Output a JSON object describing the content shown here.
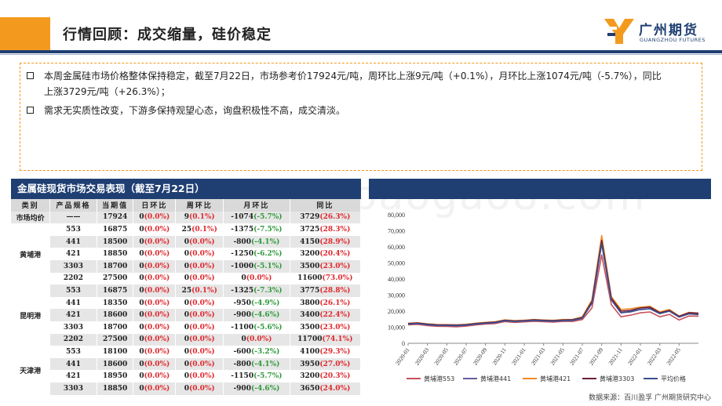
{
  "header": {
    "title": "行情回顾：成交缩量，硅价稳定",
    "logo_cn": "广州期货",
    "logo_en": "GUANGZHOU FUTURES"
  },
  "summary": {
    "bullets": [
      "本周金属硅市场价格整体保持稳定，截至7月22日，市场参考价17924元/吨，周环比上涨9元/吨（+0.1%），月环比上涨1074元/吨（-5.7%），同比上涨3729元/吨（+26.3%）；",
      "需求无实质性改变，下游多保持观望心态，询盘积极性不高，成交清淡。"
    ]
  },
  "table": {
    "title": "金属硅现货市场交易表现（截至7月22日）",
    "headers": [
      "类别",
      "产品规格",
      "当期值",
      "日环比",
      "周环比",
      "月环比",
      "同比"
    ],
    "group_labels": {
      "avg": "市场均价",
      "huangpu": "黄埔港",
      "kunming": "昆明港",
      "tianjin": "天津港"
    },
    "rows": [
      {
        "spec": "——",
        "val": "17924",
        "d": "0",
        "dp": "(0.0%)",
        "w": "9",
        "wp": "(0.1%)",
        "m": "-1074",
        "mp": "(-5.7%)",
        "y": "3729",
        "yp": "(26.3%)"
      },
      {
        "spec": "553",
        "val": "16875",
        "d": "0",
        "dp": "(0.0%)",
        "w": "25",
        "wp": "(0.1%)",
        "m": "-1375",
        "mp": "(-7.5%)",
        "y": "3725",
        "yp": "(28.3%)"
      },
      {
        "spec": "441",
        "val": "18500",
        "d": "0",
        "dp": "(0.0%)",
        "w": "0",
        "wp": "(0.0%)",
        "m": "-800",
        "mp": "(-4.1%)",
        "y": "4150",
        "yp": "(28.9%)"
      },
      {
        "spec": "421",
        "val": "18850",
        "d": "0",
        "dp": "(0.0%)",
        "w": "0",
        "wp": "(0.0%)",
        "m": "-1250",
        "mp": "(-6.2%)",
        "y": "3200",
        "yp": "(20.4%)"
      },
      {
        "spec": "3303",
        "val": "18700",
        "d": "0",
        "dp": "(0.0%)",
        "w": "0",
        "wp": "(0.0%)",
        "m": "-1000",
        "mp": "(-5.1%)",
        "y": "3500",
        "yp": "(23.0%)"
      },
      {
        "spec": "2202",
        "val": "27500",
        "d": "0",
        "dp": "(0.0%)",
        "w": "0",
        "wp": "(0.0%)",
        "m": "0",
        "mp": "(0.0%)",
        "y": "11600",
        "yp": "(73.0%)"
      },
      {
        "spec": "553",
        "val": "16875",
        "d": "0",
        "dp": "(0.0%)",
        "w": "25",
        "wp": "(0.1%)",
        "m": "-1325",
        "mp": "(-7.3%)",
        "y": "3775",
        "yp": "(28.8%)"
      },
      {
        "spec": "441",
        "val": "18350",
        "d": "0",
        "dp": "(0.0%)",
        "w": "0",
        "wp": "(0.0%)",
        "m": "-950",
        "mp": "(-4.9%)",
        "y": "3800",
        "yp": "(26.1%)"
      },
      {
        "spec": "421",
        "val": "18600",
        "d": "0",
        "dp": "(0.0%)",
        "w": "0",
        "wp": "(0.0%)",
        "m": "-900",
        "mp": "(-4.6%)",
        "y": "3400",
        "yp": "(22.4%)"
      },
      {
        "spec": "3303",
        "val": "18700",
        "d": "0",
        "dp": "(0.0%)",
        "w": "0",
        "wp": "(0.0%)",
        "m": "-1100",
        "mp": "(-5.6%)",
        "y": "3500",
        "yp": "(23.0%)"
      },
      {
        "spec": "2202",
        "val": "27500",
        "d": "0",
        "dp": "(0.0%)",
        "w": "0",
        "wp": "(0.0%)",
        "m": "0",
        "mp": "(0.0%)",
        "y": "11700",
        "yp": "(74.1%)"
      },
      {
        "spec": "553",
        "val": "18100",
        "d": "0",
        "dp": "(0.0%)",
        "w": "0",
        "wp": "(0.0%)",
        "m": "-600",
        "mp": "(-3.2%)",
        "y": "4100",
        "yp": "(29.3%)"
      },
      {
        "spec": "441",
        "val": "18600",
        "d": "0",
        "dp": "(0.0%)",
        "w": "0",
        "wp": "(0.0%)",
        "m": "-800",
        "mp": "(-4.1%)",
        "y": "3950",
        "yp": "(27.0%)"
      },
      {
        "spec": "421",
        "val": "18950",
        "d": "0",
        "dp": "(0.0%)",
        "w": "0",
        "wp": "(0.0%)",
        "m": "-1150",
        "mp": "(-5.7%)",
        "y": "3200",
        "yp": "(20.3%)"
      },
      {
        "spec": "3303",
        "val": "18850",
        "d": "0",
        "dp": "(0.0%)",
        "w": "0",
        "wp": "(0.0%)",
        "m": "-900",
        "mp": "(-4.6%)",
        "y": "3650",
        "yp": "(24.0%)"
      }
    ]
  },
  "colors": {
    "up": "#e0282e",
    "down": "#2e9a3a",
    "header_bar": "#1f3f73",
    "accent": "#f39a1e"
  },
  "chart_data": {
    "type": "line",
    "title": "",
    "ylim": [
      0,
      80000
    ],
    "yticks": [
      0,
      10000,
      20000,
      30000,
      40000,
      50000,
      60000,
      70000,
      80000
    ],
    "ytick_labels": [
      "0",
      "10,000",
      "20,000",
      "30,000",
      "40,000",
      "50,000",
      "60,000",
      "70,000",
      "80,000"
    ],
    "xtick_labels": [
      "2020-01",
      "2020-03",
      "2020-05",
      "2020-07",
      "2020-09",
      "2020-11",
      "2021-01",
      "2021-03",
      "2021-05",
      "2021-07",
      "2021-09",
      "2021-11",
      "2022-01",
      "2022-03",
      "2022-05"
    ],
    "x": [
      "2020-01",
      "2020-02",
      "2020-03",
      "2020-04",
      "2020-05",
      "2020-06",
      "2020-07",
      "2020-08",
      "2020-09",
      "2020-10",
      "2020-11",
      "2020-12",
      "2021-01",
      "2021-02",
      "2021-03",
      "2021-04",
      "2021-05",
      "2021-06",
      "2021-07",
      "2021-08",
      "2021-09",
      "2021-10",
      "2021-11",
      "2021-12",
      "2022-01",
      "2022-02",
      "2022-03",
      "2022-04",
      "2022-05",
      "2022-06",
      "2022-07"
    ],
    "series": [
      {
        "name": "黄埔港553",
        "color": "#c8505a",
        "values": [
          11500,
          11800,
          11000,
          10600,
          10500,
          10300,
          10700,
          11400,
          12000,
          12300,
          13500,
          13000,
          13300,
          13700,
          13400,
          13200,
          13600,
          13600,
          14800,
          22000,
          55000,
          24000,
          16500,
          17500,
          19000,
          19500,
          16500,
          18000,
          14500,
          17000,
          16900
        ]
      },
      {
        "name": "黄埔港441",
        "color": "#6a5aa0",
        "values": [
          12000,
          12300,
          11500,
          11100,
          11000,
          10900,
          11200,
          11900,
          12500,
          12800,
          14000,
          13500,
          13800,
          14200,
          13900,
          13700,
          14100,
          14200,
          15600,
          25000,
          62000,
          27000,
          19000,
          19500,
          21000,
          21500,
          18500,
          20000,
          16500,
          18800,
          18500
        ]
      },
      {
        "name": "黄埔港421",
        "color": "#f08a24",
        "values": [
          12500,
          12800,
          12100,
          11700,
          11600,
          11500,
          11800,
          12500,
          13000,
          13400,
          14600,
          14100,
          14400,
          14800,
          14500,
          14300,
          14800,
          14900,
          16500,
          27000,
          67000,
          29000,
          21000,
          21500,
          22500,
          23000,
          19500,
          21000,
          17000,
          19200,
          18850
        ]
      },
      {
        "name": "黄埔港3303",
        "color": "#6b1e3a",
        "values": [
          12300,
          12600,
          11900,
          11500,
          11400,
          11300,
          11600,
          12300,
          12800,
          13200,
          14300,
          13900,
          14100,
          14600,
          14300,
          14100,
          14500,
          14700,
          16000,
          26000,
          64000,
          28000,
          20000,
          20500,
          22000,
          22500,
          19000,
          20500,
          16800,
          19000,
          18700
        ]
      },
      {
        "name": "平均价格",
        "color": "#3a4f8f",
        "values": [
          12000,
          12300,
          11600,
          11200,
          11100,
          11000,
          11300,
          12000,
          12500,
          12900,
          14100,
          13600,
          13900,
          14300,
          14000,
          13800,
          14200,
          14300,
          15700,
          25000,
          62000,
          27000,
          19000,
          19800,
          21000,
          21500,
          18500,
          20000,
          16300,
          18300,
          17924
        ]
      }
    ]
  },
  "footer": {
    "source": "数据来源：百川盈孚  广州期货研究中心"
  },
  "watermark": "www.baogao8.com"
}
